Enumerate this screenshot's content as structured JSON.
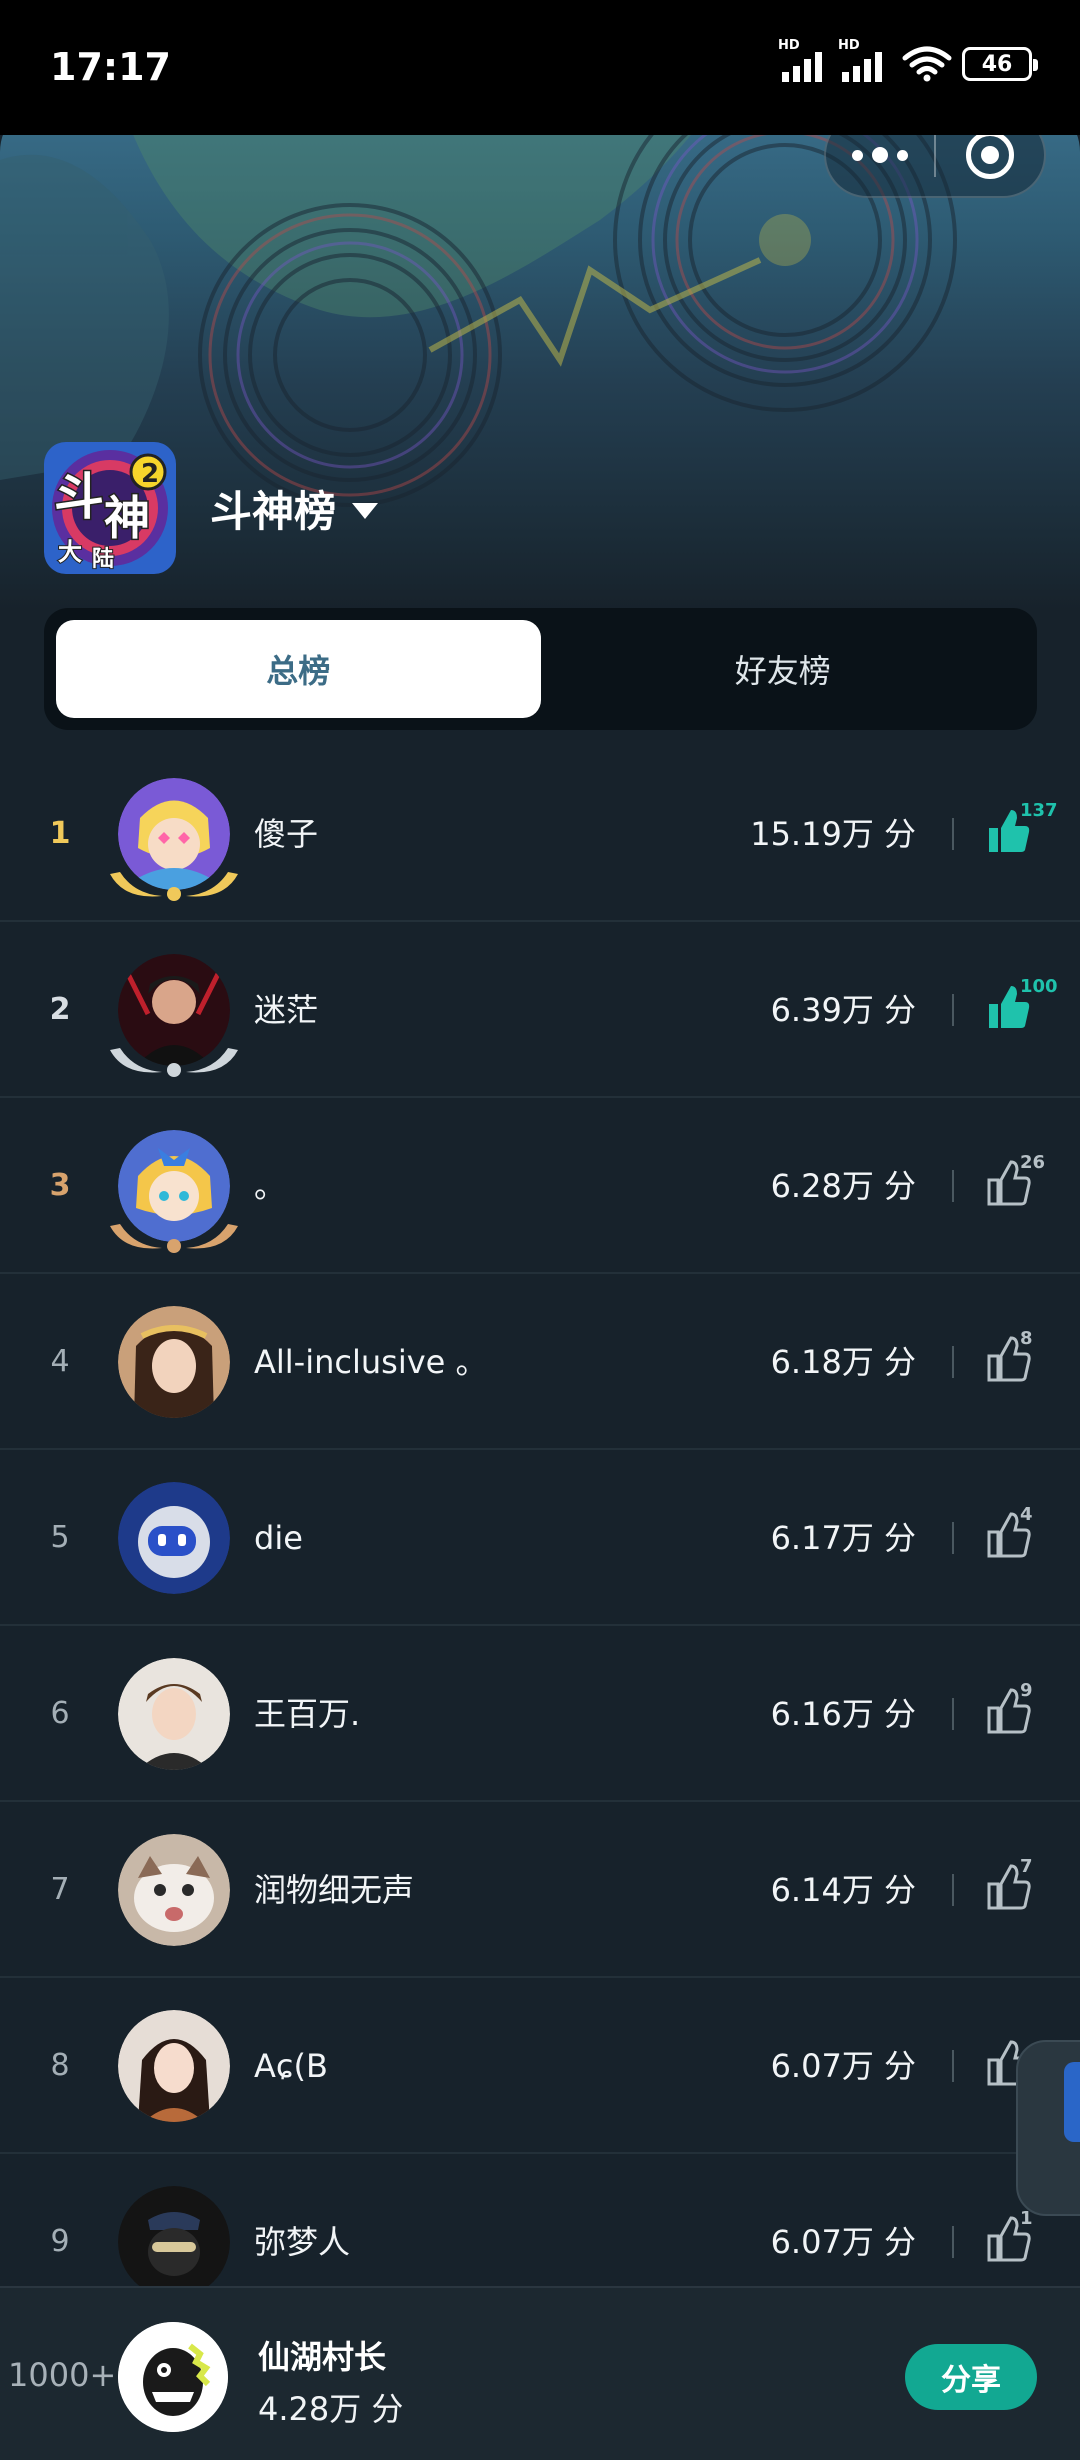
{
  "status_bar": {
    "time": "17:17",
    "battery": "46",
    "signal_labels": [
      "HD",
      "HD"
    ]
  },
  "capsule": {
    "more_icon": "more-dots-icon",
    "close_icon": "target-close-icon"
  },
  "header": {
    "board_title": "斗神榜",
    "game_logo_text": [
      "斗",
      "神",
      "大",
      "陆",
      "2"
    ]
  },
  "tabs": [
    {
      "label": "总榜",
      "active": true
    },
    {
      "label": "好友榜",
      "active": false
    }
  ],
  "rows": [
    {
      "rank": "1",
      "name": "傻子",
      "score": "15.19万 分",
      "likes": "137",
      "liked": true
    },
    {
      "rank": "2",
      "name": "迷茫",
      "score": "6.39万 分",
      "likes": "100",
      "liked": true
    },
    {
      "rank": "3",
      "name": "。",
      "score": "6.28万 分",
      "likes": "26",
      "liked": false
    },
    {
      "rank": "4",
      "name": "All-inclusive 。",
      "score": "6.18万 分",
      "likes": "8",
      "liked": false
    },
    {
      "rank": "5",
      "name": "die",
      "score": "6.17万 分",
      "likes": "4",
      "liked": false
    },
    {
      "rank": "6",
      "name": "王百万.",
      "score": "6.16万 分",
      "likes": "9",
      "liked": false
    },
    {
      "rank": "7",
      "name": "润物细无声",
      "score": "6.14万 分",
      "likes": "7",
      "liked": false
    },
    {
      "rank": "8",
      "name": "Aɕ(B",
      "score": "6.07万 分",
      "likes": "",
      "liked": false
    },
    {
      "rank": "9",
      "name": "弥梦人",
      "score": "6.07万 分",
      "likes": "1",
      "liked": false
    }
  ],
  "me": {
    "rank": "1000+",
    "name": "仙湖村长",
    "score": "4.28万 分"
  },
  "share_label": "分享",
  "colors": {
    "accent": "#12a892",
    "gold": "#f0c95a",
    "bronze": "#d8a36d",
    "background": "#17222b"
  }
}
